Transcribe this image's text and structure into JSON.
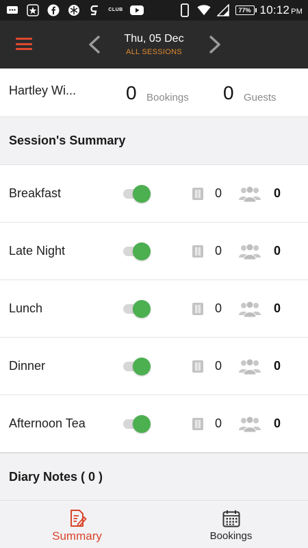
{
  "status_bar": {
    "time": "10:12",
    "ampm": "PM",
    "battery": "77%",
    "club_label": "CLUB",
    "icons": [
      "message-icon",
      "game-icon",
      "facebook-icon",
      "unknown-app-icon",
      "g-app-icon",
      "club-icon",
      "youtube-icon",
      "phone-icon",
      "wifi-icon",
      "signal-icon",
      "battery-icon"
    ]
  },
  "header": {
    "date": "Thu, 05 Dec",
    "subtitle": "ALL SESSIONS",
    "accent_color": "#e0492f",
    "subtitle_color": "#e0892f"
  },
  "venue": {
    "name": "Hartley Wi...",
    "bookings_count": "0",
    "bookings_label": "Bookings",
    "guests_count": "0",
    "guests_label": "Guests"
  },
  "sessions_summary": {
    "title": "Session's Summary",
    "items": [
      {
        "name": "Breakfast",
        "enabled": true,
        "bookings": "0",
        "guests": "0"
      },
      {
        "name": "Late Night",
        "enabled": true,
        "bookings": "0",
        "guests": "0"
      },
      {
        "name": "Lunch",
        "enabled": true,
        "bookings": "0",
        "guests": "0"
      },
      {
        "name": "Dinner",
        "enabled": true,
        "bookings": "0",
        "guests": "0"
      },
      {
        "name": "Afternoon Tea",
        "enabled": true,
        "bookings": "0",
        "guests": "0"
      }
    ],
    "toggle_on_color": "#4caf50"
  },
  "diary_notes": {
    "title": "Diary Notes ( 0 )"
  },
  "bottom_nav": {
    "items": [
      {
        "label": "Summary",
        "icon": "summary-document-icon",
        "active": true
      },
      {
        "label": "Bookings",
        "icon": "calendar-icon",
        "active": false
      }
    ],
    "active_color": "#d9442a"
  }
}
